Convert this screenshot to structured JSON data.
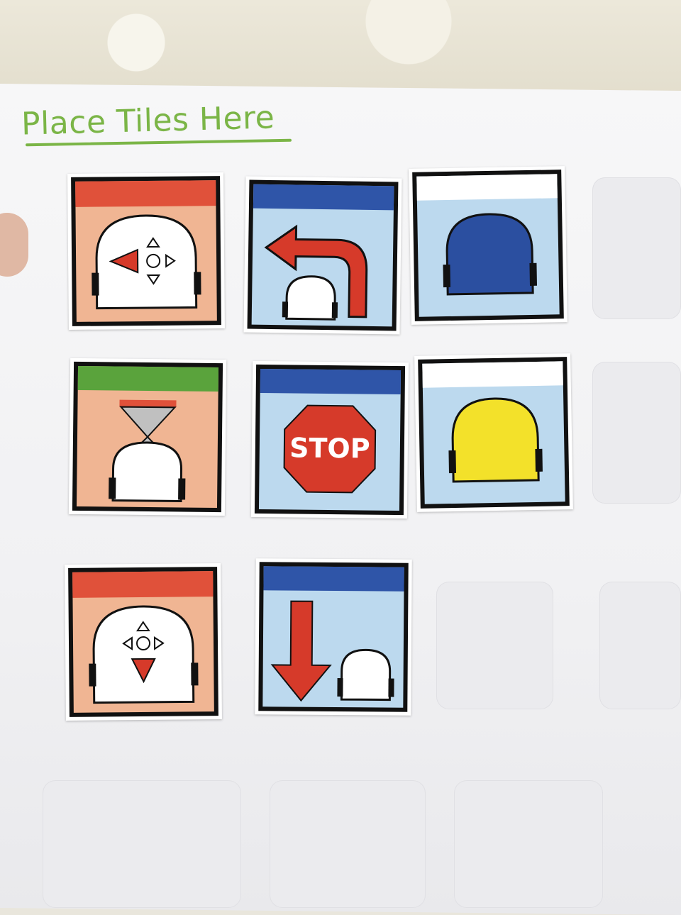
{
  "title": "Place Tiles Here",
  "colors": {
    "title_green": "#7bb547",
    "red_bar": "#e0513a",
    "blue_bar": "#2f55a8",
    "green_bar": "#5aa33c",
    "light_blue_bg": "#bcd9ee",
    "peach_bg": "#f0b593",
    "arrow_red": "#d63a2a",
    "robot_dark_blue": "#2b4fa0",
    "robot_yellow": "#f3e12a"
  },
  "tiles": [
    {
      "name": "move-left-tile",
      "icon": "robot-move-left-icon"
    },
    {
      "name": "turn-left-tile",
      "icon": "turn-left-arrow-icon"
    },
    {
      "name": "blue-robot-tile",
      "icon": "blue-robot-icon"
    },
    {
      "name": "wait-tile",
      "icon": "hourglass-robot-icon"
    },
    {
      "name": "stop-tile",
      "icon": "stop-sign-icon",
      "label": "STOP"
    },
    {
      "name": "yellow-robot-tile",
      "icon": "yellow-robot-icon"
    },
    {
      "name": "move-down-tile",
      "icon": "robot-move-down-icon"
    },
    {
      "name": "go-back-tile",
      "icon": "down-arrow-robot-icon"
    }
  ]
}
